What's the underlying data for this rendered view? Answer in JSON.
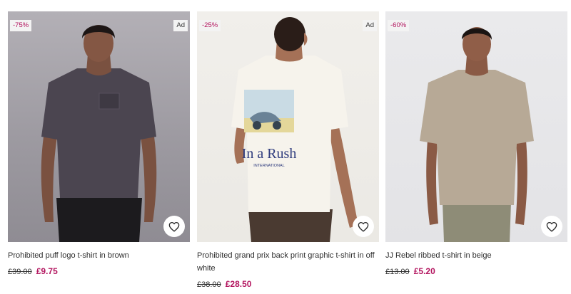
{
  "products": [
    {
      "discount": "-75%",
      "ad": "Ad",
      "title": "Prohibited puff logo t-shirt in brown",
      "old_price": "£39.00",
      "new_price": "£9.75",
      "shirt_color": "#4b4550"
    },
    {
      "discount": "-25%",
      "ad": "Ad",
      "title": "Prohibited grand prix back print graphic t-shirt in off white",
      "old_price": "£38.00",
      "new_price": "£28.50",
      "print_text": "In a Rush",
      "print_subtext": "INTERNATIONAL",
      "shirt_color": "#f6f3ec"
    },
    {
      "discount": "-60%",
      "title": "JJ Rebel ribbed t-shirt in beige",
      "old_price": "£13.00",
      "new_price": "£5.20",
      "shirt_color": "#b7a996"
    }
  ],
  "icons": {
    "wishlist": "heart-icon"
  },
  "colors": {
    "sale": "#b3155f"
  }
}
